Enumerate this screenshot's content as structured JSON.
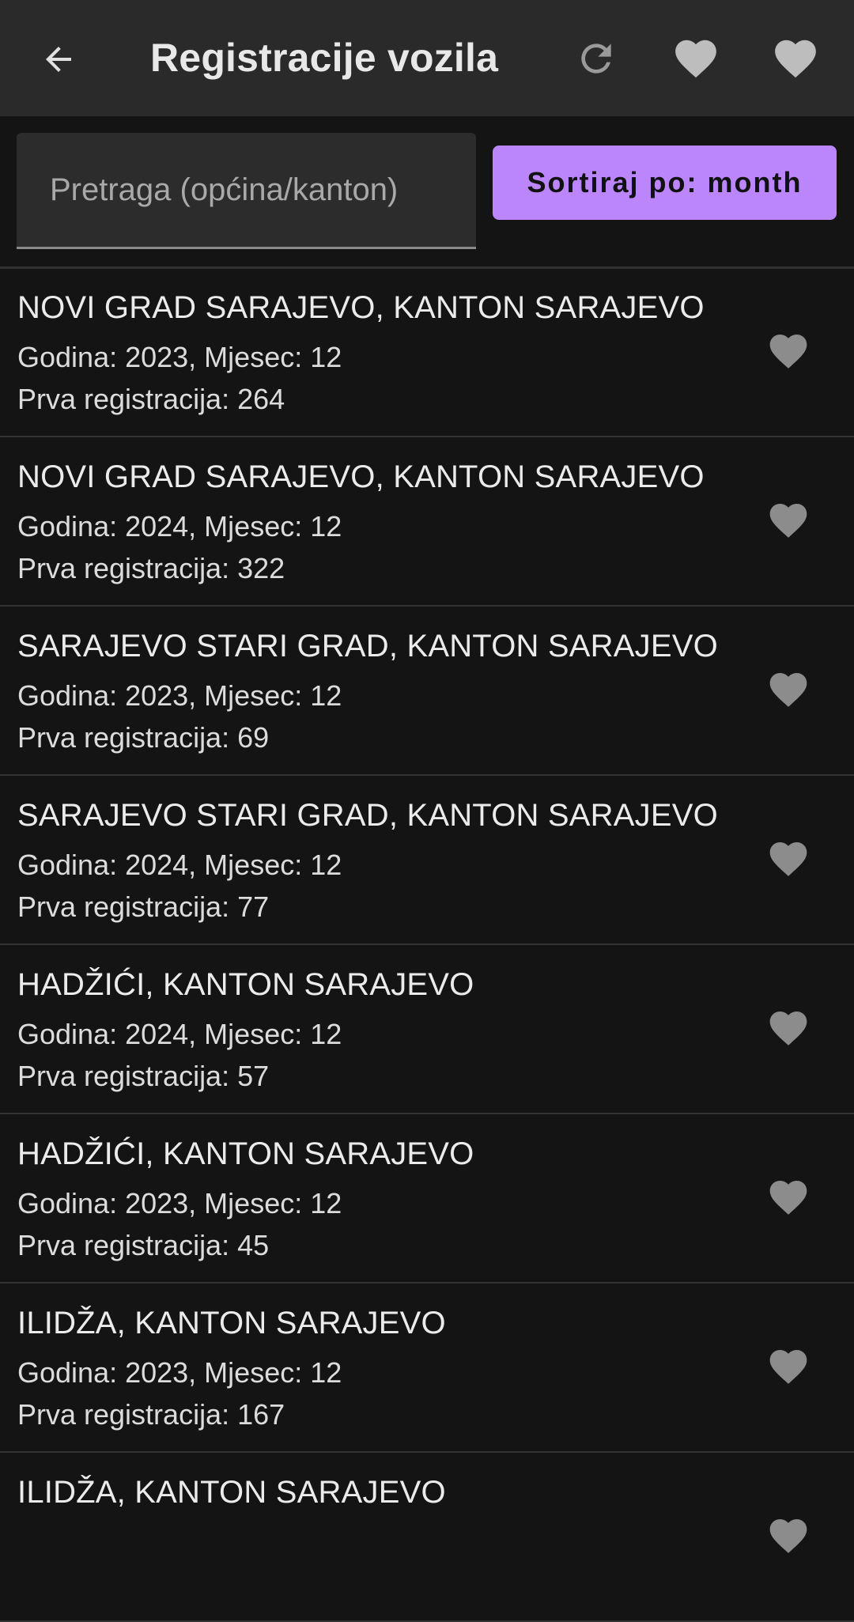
{
  "appbar": {
    "title": "Registracije vozila",
    "back_icon": "arrow-back-icon",
    "actions": [
      "refresh-icon",
      "heart-icon",
      "heart-icon"
    ],
    "icon_color": "#bdbdbd"
  },
  "search": {
    "placeholder": "Pretraga (općina/kanton)",
    "value": ""
  },
  "sort_button": {
    "label": "Sortiraj po: month",
    "color": "#bb86fc"
  },
  "items": [
    {
      "name": "NOVI GRAD SARAJEVO, KANTON SARAJEVO",
      "period": "Godina: 2023, Mjesec: 12",
      "count": "Prva registracija: 264"
    },
    {
      "name": "NOVI GRAD SARAJEVO, KANTON SARAJEVO",
      "period": "Godina: 2024, Mjesec: 12",
      "count": "Prva registracija: 322"
    },
    {
      "name": "SARAJEVO STARI GRAD, KANTON SARAJEVO",
      "period": "Godina: 2023, Mjesec: 12",
      "count": "Prva registracija: 69"
    },
    {
      "name": "SARAJEVO STARI GRAD, KANTON SARAJEVO",
      "period": "Godina: 2024, Mjesec: 12",
      "count": "Prva registracija: 77"
    },
    {
      "name": "HADŽIĆI, KANTON SARAJEVO",
      "period": "Godina: 2024, Mjesec: 12",
      "count": "Prva registracija: 57"
    },
    {
      "name": "HADŽIĆI, KANTON SARAJEVO",
      "period": "Godina: 2023, Mjesec: 12",
      "count": "Prva registracija: 45"
    },
    {
      "name": "ILIDŽA, KANTON SARAJEVO",
      "period": "Godina: 2023, Mjesec: 12",
      "count": "Prva registracija: 167"
    },
    {
      "name": "ILIDŽA, KANTON SARAJEVO",
      "period": "",
      "count": ""
    }
  ],
  "favorite_icon": "heart-icon",
  "favorite_icon_color": "#8c8c8c"
}
